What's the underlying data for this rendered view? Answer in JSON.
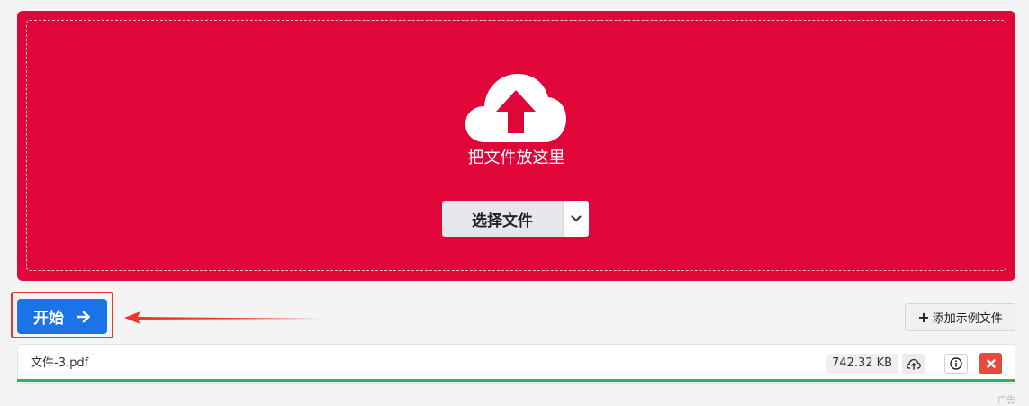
{
  "dropzone": {
    "background_color": "#e0063a",
    "icon": "cloud-upload-icon",
    "drop_text": "把文件放这里",
    "choose_button_label": "选择文件",
    "dropdown_icon": "chevron-down-icon"
  },
  "actions": {
    "start_button_label": "开始",
    "start_icon": "arrow-right-icon",
    "start_color": "#1a73e8",
    "highlight_color": "#e53a2b",
    "add_sample_label": "添加示例文件",
    "add_sample_icon": "plus-icon"
  },
  "files": [
    {
      "name": "文件-3.pdf",
      "size": "742.32 KB",
      "progress_percent": 100,
      "progress_color": "#1ebd56",
      "icons": [
        "upload-cloud-icon",
        "info-icon",
        "close-icon"
      ]
    }
  ],
  "ad_label": "广告"
}
